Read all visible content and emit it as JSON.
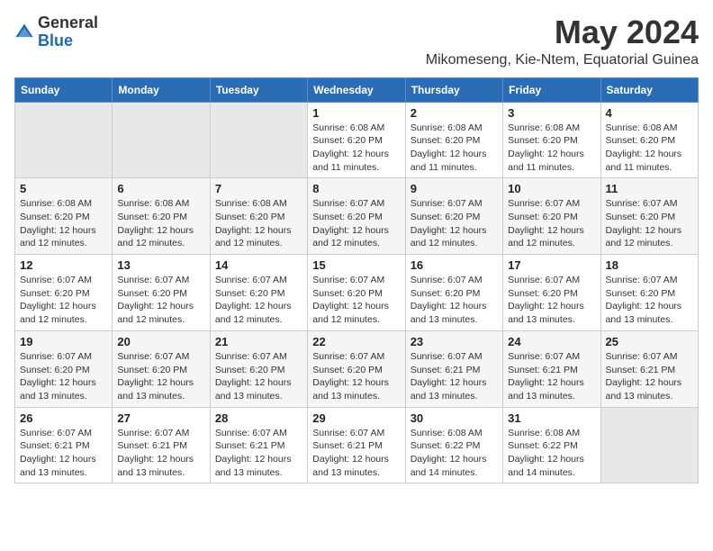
{
  "header": {
    "logo_general": "General",
    "logo_blue": "Blue",
    "month_year": "May 2024",
    "location": "Mikomeseng, Kie-Ntem, Equatorial Guinea"
  },
  "weekdays": [
    "Sunday",
    "Monday",
    "Tuesday",
    "Wednesday",
    "Thursday",
    "Friday",
    "Saturday"
  ],
  "weeks": [
    [
      {
        "day": "",
        "info": ""
      },
      {
        "day": "",
        "info": ""
      },
      {
        "day": "",
        "info": ""
      },
      {
        "day": "1",
        "info": "Sunrise: 6:08 AM\nSunset: 6:20 PM\nDaylight: 12 hours\nand 11 minutes."
      },
      {
        "day": "2",
        "info": "Sunrise: 6:08 AM\nSunset: 6:20 PM\nDaylight: 12 hours\nand 11 minutes."
      },
      {
        "day": "3",
        "info": "Sunrise: 6:08 AM\nSunset: 6:20 PM\nDaylight: 12 hours\nand 11 minutes."
      },
      {
        "day": "4",
        "info": "Sunrise: 6:08 AM\nSunset: 6:20 PM\nDaylight: 12 hours\nand 11 minutes."
      }
    ],
    [
      {
        "day": "5",
        "info": "Sunrise: 6:08 AM\nSunset: 6:20 PM\nDaylight: 12 hours\nand 12 minutes."
      },
      {
        "day": "6",
        "info": "Sunrise: 6:08 AM\nSunset: 6:20 PM\nDaylight: 12 hours\nand 12 minutes."
      },
      {
        "day": "7",
        "info": "Sunrise: 6:08 AM\nSunset: 6:20 PM\nDaylight: 12 hours\nand 12 minutes."
      },
      {
        "day": "8",
        "info": "Sunrise: 6:07 AM\nSunset: 6:20 PM\nDaylight: 12 hours\nand 12 minutes."
      },
      {
        "day": "9",
        "info": "Sunrise: 6:07 AM\nSunset: 6:20 PM\nDaylight: 12 hours\nand 12 minutes."
      },
      {
        "day": "10",
        "info": "Sunrise: 6:07 AM\nSunset: 6:20 PM\nDaylight: 12 hours\nand 12 minutes."
      },
      {
        "day": "11",
        "info": "Sunrise: 6:07 AM\nSunset: 6:20 PM\nDaylight: 12 hours\nand 12 minutes."
      }
    ],
    [
      {
        "day": "12",
        "info": "Sunrise: 6:07 AM\nSunset: 6:20 PM\nDaylight: 12 hours\nand 12 minutes."
      },
      {
        "day": "13",
        "info": "Sunrise: 6:07 AM\nSunset: 6:20 PM\nDaylight: 12 hours\nand 12 minutes."
      },
      {
        "day": "14",
        "info": "Sunrise: 6:07 AM\nSunset: 6:20 PM\nDaylight: 12 hours\nand 12 minutes."
      },
      {
        "day": "15",
        "info": "Sunrise: 6:07 AM\nSunset: 6:20 PM\nDaylight: 12 hours\nand 12 minutes."
      },
      {
        "day": "16",
        "info": "Sunrise: 6:07 AM\nSunset: 6:20 PM\nDaylight: 12 hours\nand 13 minutes."
      },
      {
        "day": "17",
        "info": "Sunrise: 6:07 AM\nSunset: 6:20 PM\nDaylight: 12 hours\nand 13 minutes."
      },
      {
        "day": "18",
        "info": "Sunrise: 6:07 AM\nSunset: 6:20 PM\nDaylight: 12 hours\nand 13 minutes."
      }
    ],
    [
      {
        "day": "19",
        "info": "Sunrise: 6:07 AM\nSunset: 6:20 PM\nDaylight: 12 hours\nand 13 minutes."
      },
      {
        "day": "20",
        "info": "Sunrise: 6:07 AM\nSunset: 6:20 PM\nDaylight: 12 hours\nand 13 minutes."
      },
      {
        "day": "21",
        "info": "Sunrise: 6:07 AM\nSunset: 6:20 PM\nDaylight: 12 hours\nand 13 minutes."
      },
      {
        "day": "22",
        "info": "Sunrise: 6:07 AM\nSunset: 6:20 PM\nDaylight: 12 hours\nand 13 minutes."
      },
      {
        "day": "23",
        "info": "Sunrise: 6:07 AM\nSunset: 6:21 PM\nDaylight: 12 hours\nand 13 minutes."
      },
      {
        "day": "24",
        "info": "Sunrise: 6:07 AM\nSunset: 6:21 PM\nDaylight: 12 hours\nand 13 minutes."
      },
      {
        "day": "25",
        "info": "Sunrise: 6:07 AM\nSunset: 6:21 PM\nDaylight: 12 hours\nand 13 minutes."
      }
    ],
    [
      {
        "day": "26",
        "info": "Sunrise: 6:07 AM\nSunset: 6:21 PM\nDaylight: 12 hours\nand 13 minutes."
      },
      {
        "day": "27",
        "info": "Sunrise: 6:07 AM\nSunset: 6:21 PM\nDaylight: 12 hours\nand 13 minutes."
      },
      {
        "day": "28",
        "info": "Sunrise: 6:07 AM\nSunset: 6:21 PM\nDaylight: 12 hours\nand 13 minutes."
      },
      {
        "day": "29",
        "info": "Sunrise: 6:07 AM\nSunset: 6:21 PM\nDaylight: 12 hours\nand 13 minutes."
      },
      {
        "day": "30",
        "info": "Sunrise: 6:08 AM\nSunset: 6:22 PM\nDaylight: 12 hours\nand 14 minutes."
      },
      {
        "day": "31",
        "info": "Sunrise: 6:08 AM\nSunset: 6:22 PM\nDaylight: 12 hours\nand 14 minutes."
      },
      {
        "day": "",
        "info": ""
      }
    ]
  ]
}
